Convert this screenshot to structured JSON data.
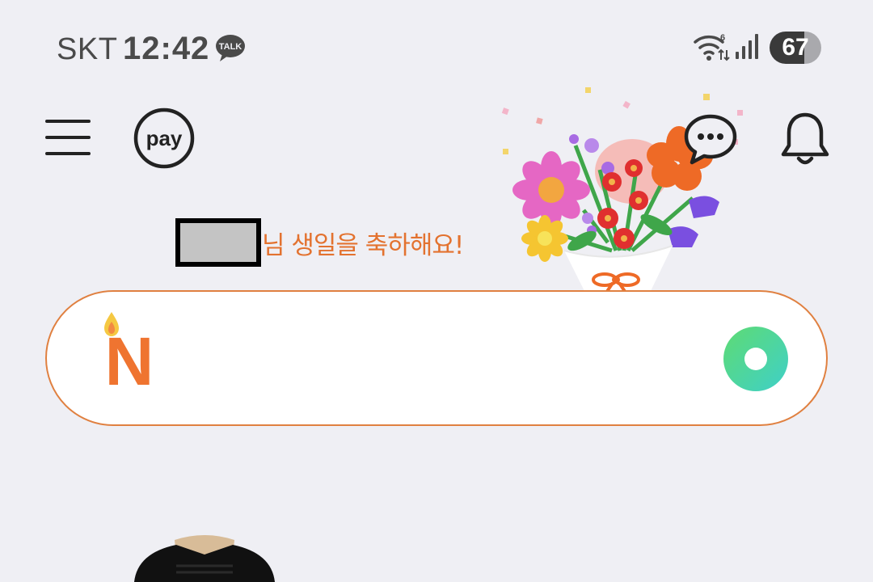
{
  "status_bar": {
    "carrier": "SKT",
    "time": "12:42",
    "talk_badge": "TALK",
    "wifi_badge": "6",
    "battery_percent": "67",
    "icons": [
      "talk-icon",
      "wifi-icon",
      "signal-icon",
      "battery-icon"
    ]
  },
  "header": {
    "pay_label": "pay",
    "icons": [
      "menu-icon",
      "pay-icon",
      "chat-icon",
      "bell-icon"
    ]
  },
  "birthday": {
    "message": "님 생일을 축하해요!"
  },
  "search": {
    "logo_letter": "N",
    "icons": [
      "candle-icon",
      "green-dot-icon"
    ]
  },
  "colors": {
    "accent": "#e3722f",
    "background": "#efeff4",
    "search_border": "#e08040",
    "naver_orange": "#ef7430",
    "green_gradient_start": "#5edb73",
    "green_gradient_end": "#3fd0c8"
  }
}
